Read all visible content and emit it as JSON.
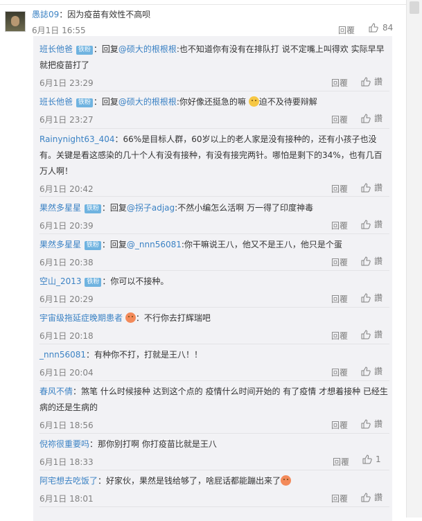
{
  "main_comment": {
    "username": "愚誌09",
    "separator": "：",
    "text": "因为疫苗有效性不高呗",
    "time": "6月1日 16:55",
    "reply_label": "回覆",
    "like_count": "84"
  },
  "replies": [
    {
      "user": "班长他爸",
      "badge": "铁粉",
      "pre": "：回复",
      "mention": "@硕大的根根根",
      "text": ":也不知道你有没有在排队打 说不定嘴上叫得欢 实际早早就把疫苗打了",
      "time": "6月1日 23:29",
      "reply_label": "回覆",
      "like_label": "讚"
    },
    {
      "user": "班长他爸",
      "badge": "铁粉",
      "pre": "：回复",
      "mention": "@硕大的根根根",
      "text": ":你好像还挺急的嘛",
      "text2": "迫不及待要辩解",
      "time": "6月1日 23:27",
      "reply_label": "回覆",
      "like_label": "讚"
    },
    {
      "user": "Rainynight63_404",
      "pre": "：",
      "text": "66%是目标人群，60岁以上的老人家是没有接种的，还有小孩子也没有。关键是看这感染的几十个人有没有接种，有没有接完两针。哪怕是剩下的34%，也有几百万人啊！",
      "time": "6月1日 20:42",
      "reply_label": "回覆",
      "like_label": "讚"
    },
    {
      "user": "果然多星星",
      "badge": "铁粉",
      "pre": "：回复",
      "mention": "@拐子adjag",
      "text": ":不然小编怎么活啊 万一得了印度神毒",
      "time": "6月1日 20:39",
      "reply_label": "回覆",
      "like_label": "讚"
    },
    {
      "user": "果然多星星",
      "badge": "铁粉",
      "pre": "：回复",
      "mention": "@_nnn56081",
      "text": ":你干嘛说王八，他又不是王八，他只是个蛋",
      "time": "6月1日 20:38",
      "reply_label": "回覆",
      "like_label": "讚"
    },
    {
      "user": "空山_2013",
      "badge": "铁粉",
      "pre": "：",
      "text": "你可以不接种。",
      "time": "6月1日 20:29",
      "reply_label": "回覆",
      "like_label": "讚"
    },
    {
      "user": "宇宙级拖延症晚期患者",
      "pre": "：",
      "text": "不行你去打辉瑞吧",
      "time": "6月1日 20:18",
      "reply_label": "回覆",
      "like_label": "讚"
    },
    {
      "user": "_nnn56081",
      "pre": "：",
      "text": "有种你不打，打就是王八！！",
      "time": "6月1日 20:04",
      "reply_label": "回覆",
      "like_label": "讚"
    },
    {
      "user": "春风不倩",
      "pre": "：",
      "text": "煞笔  什么时候接种 达到这个点的   疫情什么时间开始的   有了疫情 才想着接种 已经生病的还是生病的",
      "time": "6月1日 18:56",
      "reply_label": "回覆",
      "like_label": "讚"
    },
    {
      "user": "倪祢很重要吗",
      "pre": "：",
      "text": "那你别打啊 你打疫苗比就是王八",
      "time": "6月1日 18:33",
      "reply_label": "回覆",
      "like_label": "1"
    },
    {
      "user": "阿宅想去吃饭了",
      "pre": "：",
      "text": "好家伙，果然是钱给够了，啥屁话都能蹦出来了",
      "time": "6月1日 18:01",
      "reply_label": "回覆",
      "like_label": "讚"
    }
  ]
}
